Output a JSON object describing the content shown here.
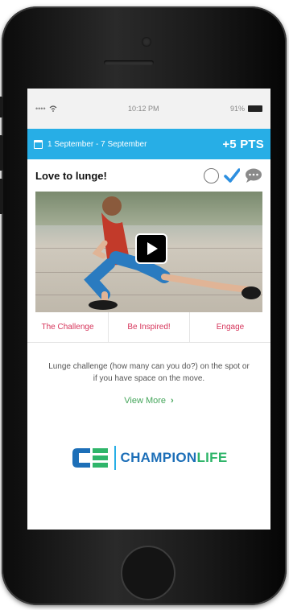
{
  "statusbar": {
    "carrier": "•••• ",
    "time": "10:12 PM",
    "battery": "91%"
  },
  "week": {
    "date_range": "1 September - 7 September",
    "points": "+5 PTS"
  },
  "challenge": {
    "title": "Love to lunge!",
    "description": "Lunge challenge (how many can you do?) on the spot or if you have space on the move.",
    "view_more": "View More",
    "view_more_chevron": "›"
  },
  "tabs": [
    {
      "label": "The Challenge"
    },
    {
      "label": "Be Inspired!"
    },
    {
      "label": "Engage"
    }
  ],
  "logo": {
    "champion": "CHAMPION",
    "life": "LIFE"
  },
  "colors": {
    "week_bar": "#27aee6",
    "tab_text": "#d6355b",
    "link": "#44a55a",
    "logo_blue": "#1d6fb8",
    "logo_green": "#2fb56a",
    "check": "#2d8fe0"
  },
  "icons": [
    "calendar-icon",
    "circle-icon",
    "check-icon",
    "chat-icon",
    "play-icon",
    "chevron-right-icon",
    "wifi-icon",
    "battery-icon"
  ]
}
